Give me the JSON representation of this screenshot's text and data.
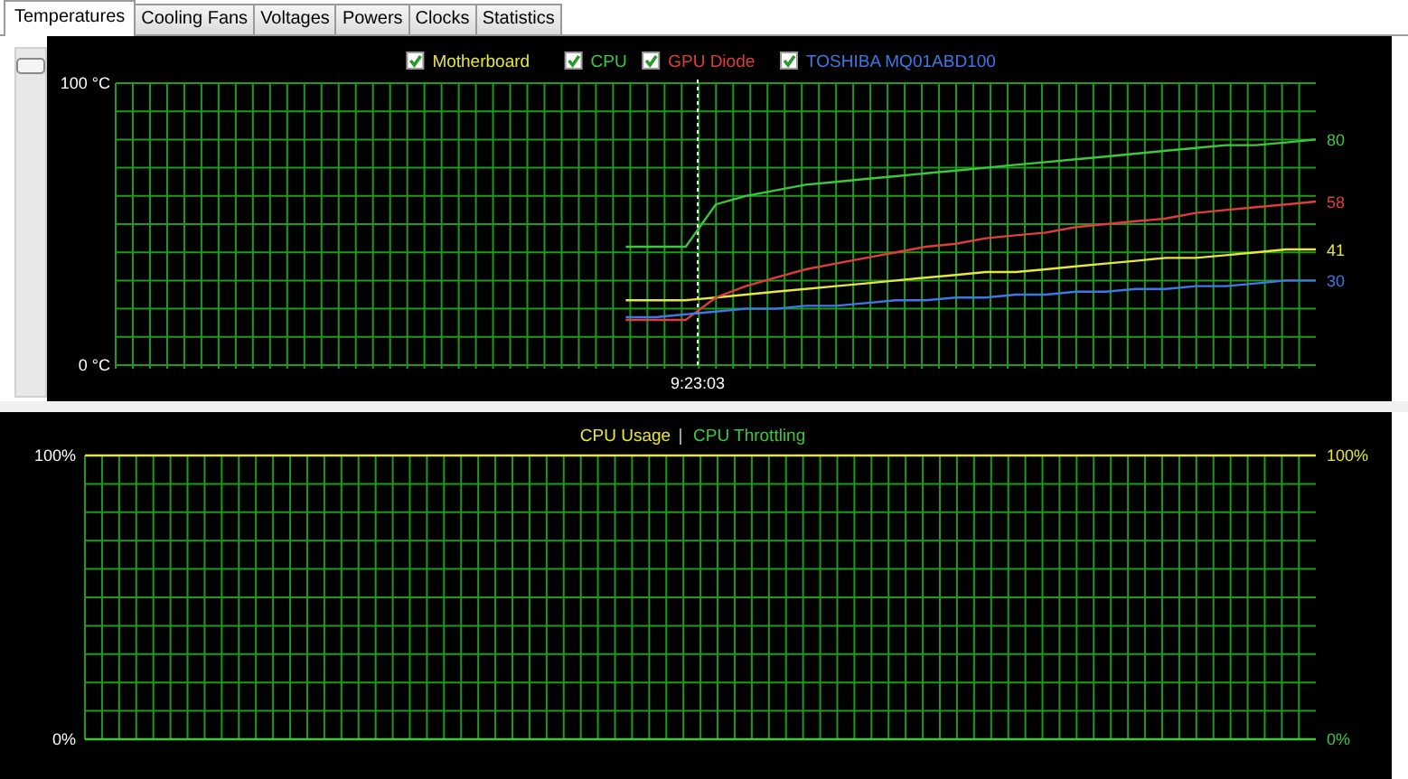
{
  "tabs": [
    {
      "label": "Temperatures",
      "selected": true
    },
    {
      "label": "Cooling Fans",
      "selected": false
    },
    {
      "label": "Voltages",
      "selected": false
    },
    {
      "label": "Powers",
      "selected": false
    },
    {
      "label": "Clocks",
      "selected": false
    },
    {
      "label": "Statistics",
      "selected": false
    }
  ],
  "temperature_panel": {
    "legend": [
      {
        "checked": true
      },
      {
        "checked": true
      },
      {
        "checked": true
      },
      {
        "checked": true
      }
    ],
    "chart_data": {
      "type": "line",
      "grid": true,
      "categories": [
        null,
        null,
        null,
        null,
        null,
        null,
        null,
        null,
        null,
        null,
        null,
        null,
        null,
        null,
        null,
        null,
        null,
        null,
        null,
        null,
        null,
        null,
        null,
        null,
        null,
        null,
        null,
        null,
        null,
        null,
        null,
        null,
        null,
        null,
        null,
        null,
        null,
        null,
        null,
        null,
        null
      ],
      "ylim": [
        0,
        100
      ],
      "yticks": [
        {
          "value": 0,
          "label": "0 °C"
        },
        {
          "value": 100,
          "label": "100 °C"
        }
      ],
      "annotations": [
        "9:23:03"
      ],
      "series": [
        {
          "name": "Motherboard",
          "color": "#e6e63c",
          "values": [
            null,
            null,
            null,
            null,
            null,
            null,
            null,
            null,
            null,
            null,
            null,
            null,
            null,
            null,
            null,
            null,
            null,
            23,
            23,
            23,
            24,
            25,
            26,
            27,
            28,
            29,
            30,
            31,
            32,
            33,
            33,
            34,
            35,
            36,
            37,
            38,
            38,
            39,
            40,
            41,
            41
          ]
        },
        {
          "name": "CPU",
          "color": "#3cc83c",
          "values": [
            null,
            null,
            null,
            null,
            null,
            null,
            null,
            null,
            null,
            null,
            null,
            null,
            null,
            null,
            null,
            null,
            null,
            42,
            42,
            42,
            57,
            60,
            62,
            64,
            65,
            66,
            67,
            68,
            69,
            70,
            71,
            72,
            73,
            74,
            75,
            76,
            77,
            78,
            78,
            79,
            80
          ]
        },
        {
          "name": "GPU Diode",
          "color": "#e03c3c",
          "values": [
            null,
            null,
            null,
            null,
            null,
            null,
            null,
            null,
            null,
            null,
            null,
            null,
            null,
            null,
            null,
            null,
            null,
            16,
            16,
            16,
            24,
            28,
            31,
            34,
            36,
            38,
            40,
            42,
            43,
            45,
            46,
            47,
            49,
            50,
            51,
            52,
            54,
            55,
            56,
            57,
            58
          ]
        },
        {
          "name": "TOSHIBA MQ01ABD100",
          "color": "#3c78e6",
          "values": [
            null,
            null,
            null,
            null,
            null,
            null,
            null,
            null,
            null,
            null,
            null,
            null,
            null,
            null,
            null,
            null,
            null,
            17,
            17,
            18,
            19,
            20,
            20,
            21,
            21,
            22,
            23,
            23,
            24,
            24,
            25,
            25,
            26,
            26,
            27,
            27,
            28,
            28,
            29,
            30,
            30
          ]
        }
      ],
      "value_labels": [
        "41",
        "80",
        "58",
        "30"
      ]
    }
  },
  "cpu_panel": {
    "legend": [
      {
        "label": "CPU Usage",
        "color": "#e6e63c"
      },
      {
        "label": "CPU Throttling",
        "color": "#3cc83c"
      }
    ],
    "separator": "|",
    "left_axis_labels": [
      "100%",
      "0%"
    ],
    "right_axis_labels": [
      "100%",
      "0%"
    ]
  }
}
